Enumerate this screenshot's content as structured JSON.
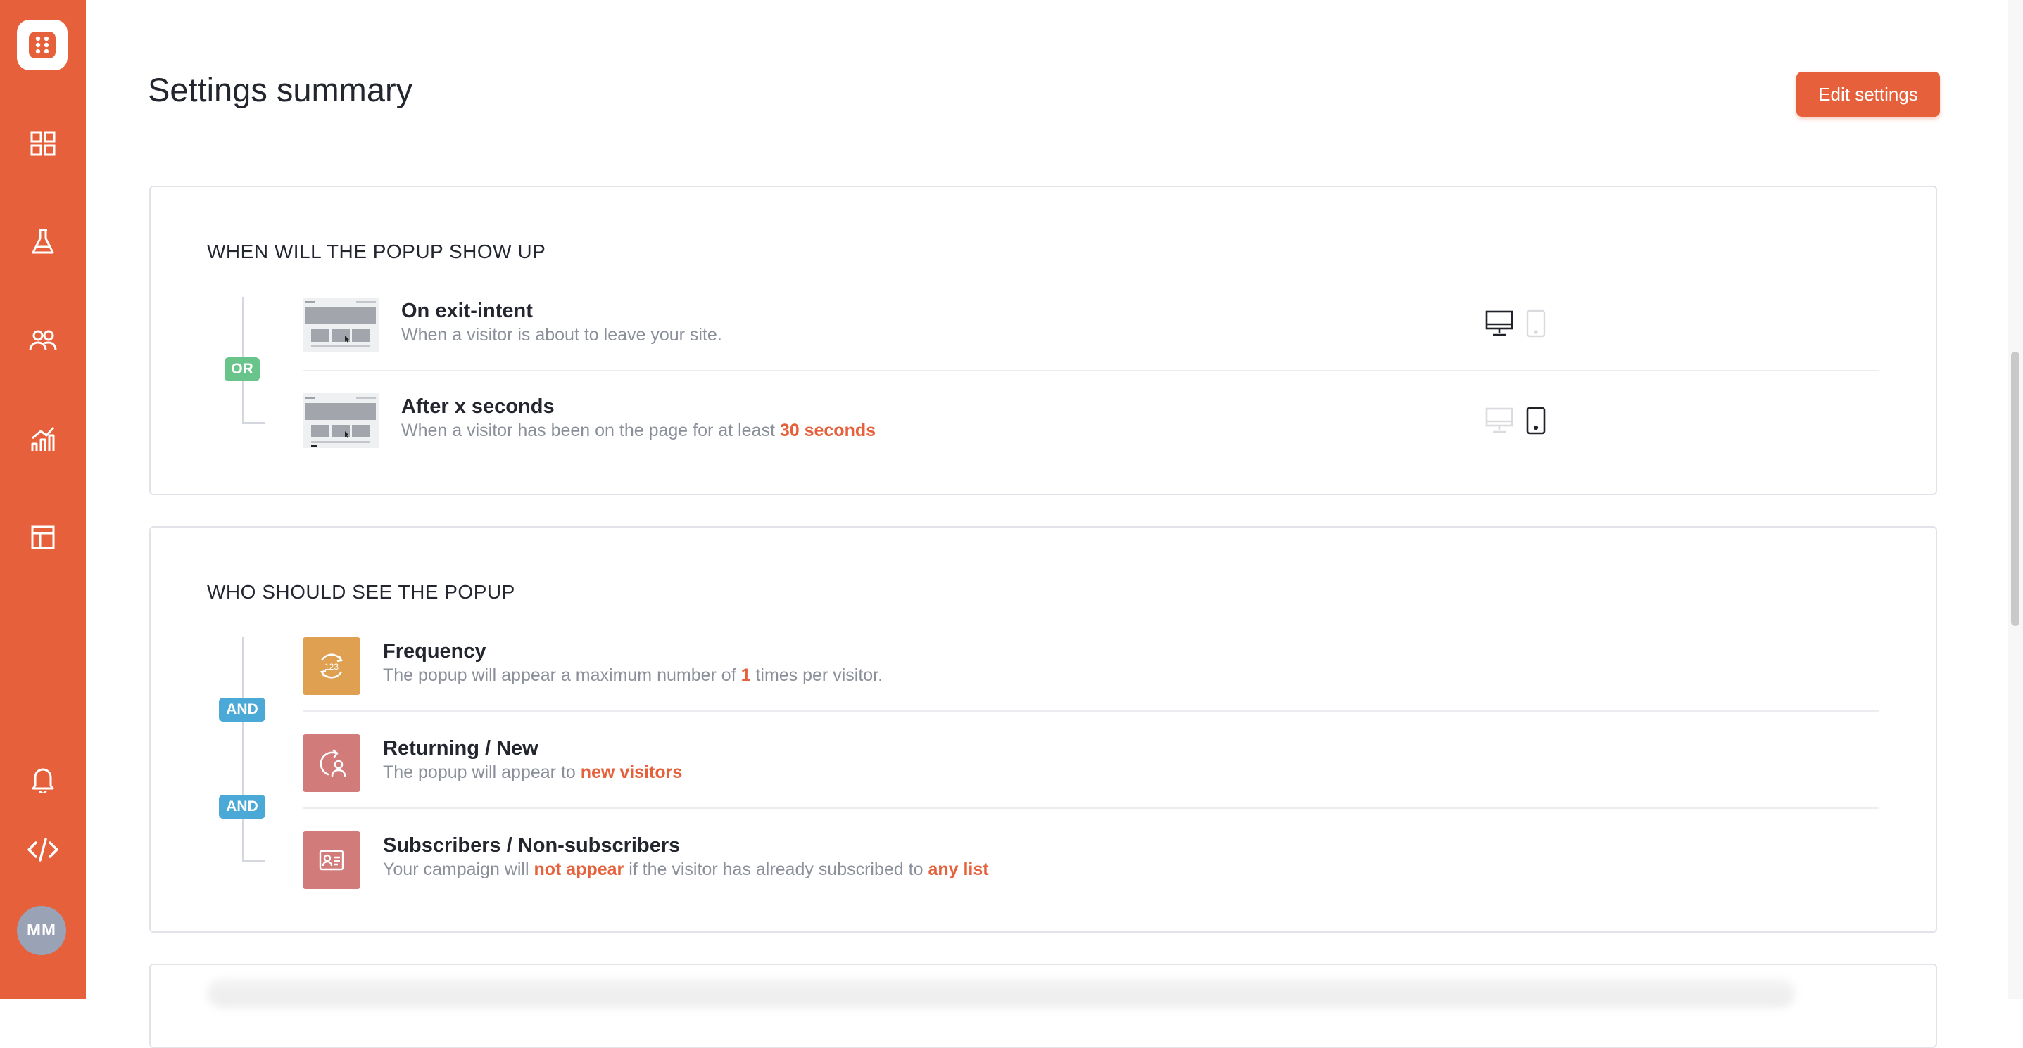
{
  "sidebar": {
    "nav": [
      {
        "icon": "dashboard-grid-icon"
      },
      {
        "icon": "flask-icon"
      },
      {
        "icon": "users-icon"
      },
      {
        "icon": "analytics-chart-icon"
      },
      {
        "icon": "layout-template-icon"
      }
    ],
    "bottom": [
      {
        "icon": "bell-icon"
      },
      {
        "icon": "code-icon"
      }
    ],
    "avatar_initials": "MM"
  },
  "header": {
    "title": "Settings summary",
    "edit_button": "Edit settings"
  },
  "when_section": {
    "title": "WHEN WILL THE POPUP SHOW UP",
    "operator": "OR",
    "rules": [
      {
        "title": "On exit-intent",
        "description": "When a visitor is about to leave your site.",
        "devices": {
          "desktop": true,
          "mobile": false
        }
      },
      {
        "title": "After x seconds",
        "description": "When a visitor has been on the page for at least",
        "highlight": "30 seconds",
        "devices": {
          "desktop": false,
          "mobile": true
        }
      }
    ]
  },
  "who_section": {
    "title": "WHO SHOULD SEE THE POPUP",
    "operators": [
      "AND",
      "AND"
    ],
    "rules": [
      {
        "title": "Frequency",
        "icon": "frequency-123-icon",
        "color": "#dfa052",
        "desc_before": "The popup will appear a maximum number of",
        "highlight": "1",
        "desc_after": "times per visitor."
      },
      {
        "title": "Returning / New",
        "icon": "returning-visitor-icon",
        "color": "#d27b7b",
        "desc_before": "The popup will appear to",
        "highlight": "new visitors"
      },
      {
        "title": "Subscribers / Non-subscribers",
        "icon": "subscriber-card-icon",
        "color": "#d27b7b",
        "desc_before": "Your campaign will",
        "highlight1": "not appear",
        "desc_middle": "if the visitor has already subscribed to",
        "highlight2": "any list"
      }
    ]
  },
  "colors": {
    "accent": "#e5603b",
    "or_badge": "#68c48a",
    "and_badge": "#4ba9d8"
  }
}
